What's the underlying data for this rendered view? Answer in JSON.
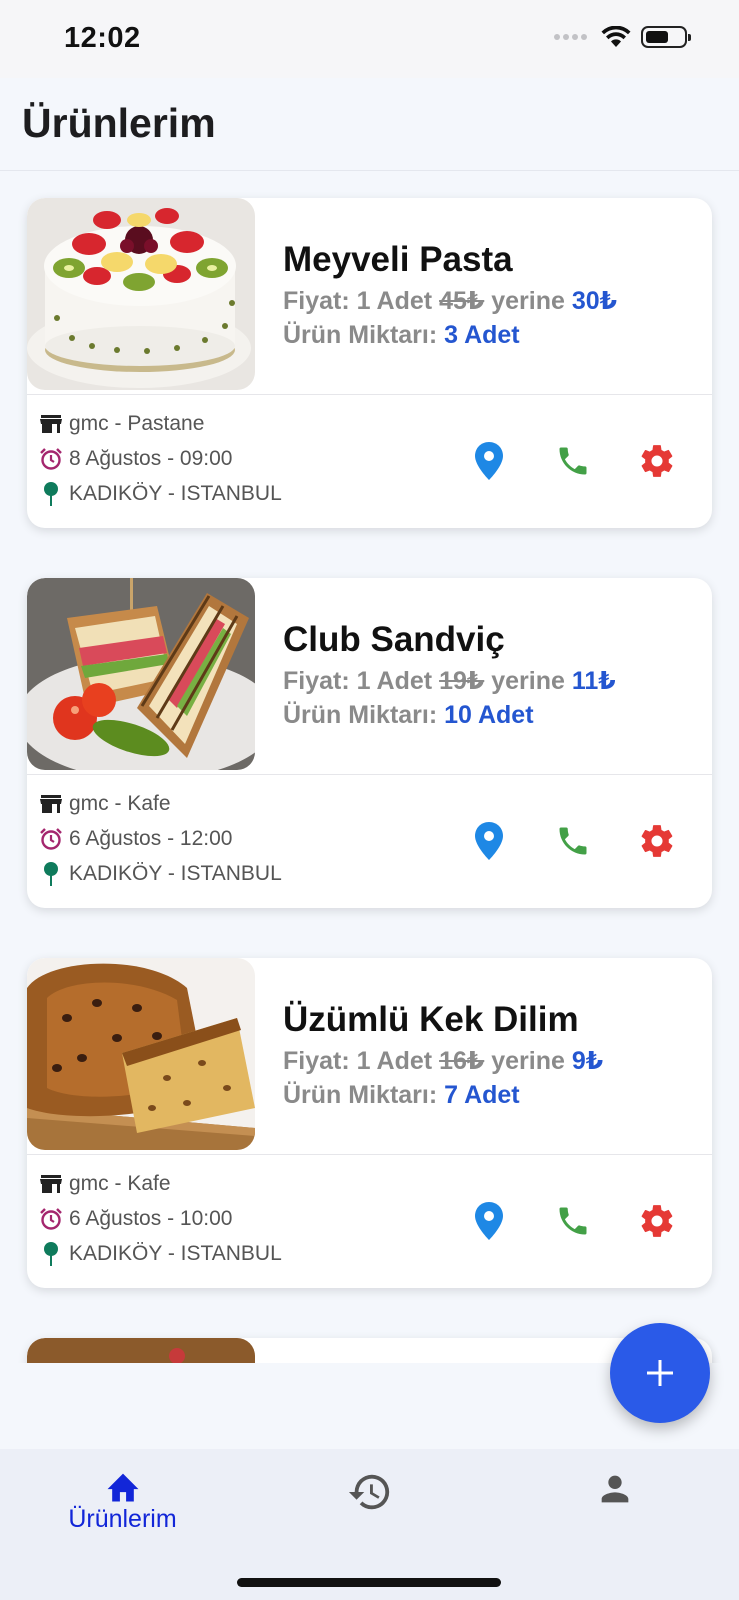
{
  "status_bar": {
    "time": "12:02"
  },
  "page": {
    "title": "Ürünlerim"
  },
  "products": [
    {
      "name": "Meyveli Pasta",
      "price_prefix": "Fiyat: 1 Adet",
      "old_price": "45₺",
      "price_mid": "yerine",
      "new_price": "30₺",
      "qty_label": "Ürün Miktarı:",
      "qty_value": "3 Adet",
      "shop": "gmc  - Pastane",
      "time": "8 Ağustos - 09:00",
      "location": "KADIKÖY - ISTANBUL",
      "image": "fruit-cake"
    },
    {
      "name": "Club Sandviç",
      "price_prefix": "Fiyat: 1 Adet",
      "old_price": "19₺",
      "price_mid": "yerine",
      "new_price": "11₺",
      "qty_label": "Ürün Miktarı:",
      "qty_value": "10 Adet",
      "shop": "gmc  - Kafe",
      "time": "6 Ağustos - 12:00",
      "location": "KADIKÖY - ISTANBUL",
      "image": "club-sandwich"
    },
    {
      "name": "Üzümlü Kek Dilim",
      "price_prefix": "Fiyat: 1 Adet",
      "old_price": "16₺",
      "price_mid": "yerine",
      "new_price": "9₺",
      "qty_label": "Ürün Miktarı:",
      "qty_value": "7 Adet",
      "shop": "gmc  - Kafe",
      "time": "6 Ağustos - 10:00",
      "location": "KADIKÖY - ISTANBUL",
      "image": "raisin-cake"
    }
  ],
  "bottom_nav": {
    "items": [
      {
        "label": "Ürünlerim",
        "icon": "home-icon",
        "active": true
      },
      {
        "label": "",
        "icon": "history-icon",
        "active": false
      },
      {
        "label": "",
        "icon": "person-icon",
        "active": false
      }
    ]
  },
  "colors": {
    "accent": "#2456d0",
    "fab": "#2a5ae8",
    "location": "#1e88e5",
    "call": "#43a047",
    "settings": "#e53935",
    "nav_active": "#1226d8"
  },
  "icons": {
    "shop": "store-icon",
    "time": "alarm-icon",
    "location_pin": "pin-icon",
    "location_button": "location-marker-icon",
    "call": "phone-icon",
    "settings": "gear-icon",
    "fab": "plus-icon"
  }
}
